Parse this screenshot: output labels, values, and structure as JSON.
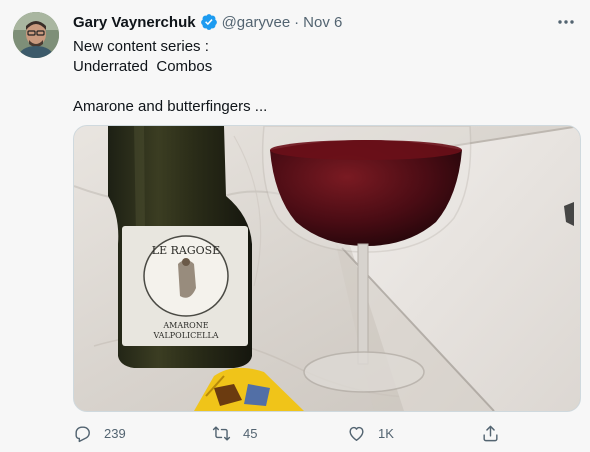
{
  "author": {
    "name": "Gary Vaynerchuk",
    "handle": "@garyvee",
    "separator": "·",
    "date": "Nov 6"
  },
  "tweet": {
    "text": "New content series :\nUnderrated  Combos\n\nAmarone and butterfingers ..."
  },
  "media": {
    "label_top": "LE RAGOSE",
    "label_bottom": "AMARONE\nVALPOLICELLA"
  },
  "actions": {
    "reply_count": "239",
    "retweet_count": "45",
    "like_count": "1K"
  },
  "colors": {
    "verified": "#1d9bf0",
    "muted": "#536471"
  },
  "icons": [
    "verified-badge-icon",
    "more-options-icon",
    "reply-icon",
    "retweet-icon",
    "like-icon",
    "share-icon"
  ]
}
